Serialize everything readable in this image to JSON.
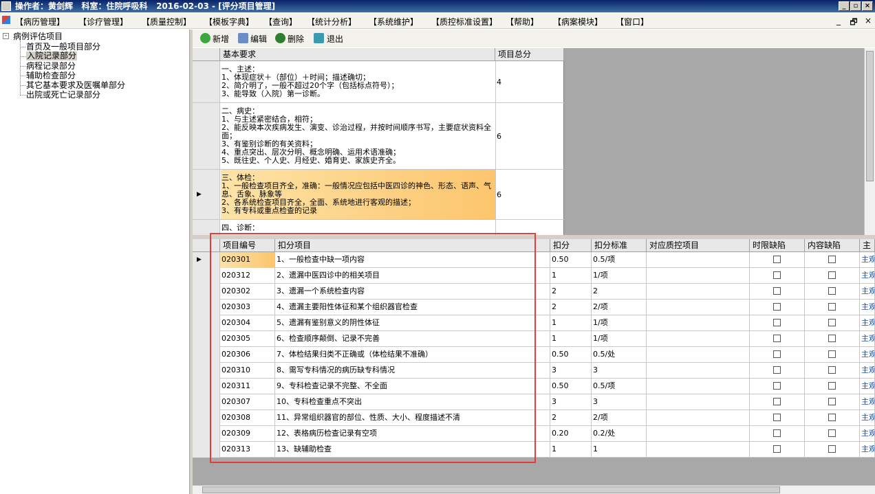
{
  "window": {
    "title": "操作者：黄剑辉   科室：住院呼吸科   2016-02-03 - [评分项目管理]",
    "min_label": "_",
    "restore_label": "▫",
    "close_label": "×"
  },
  "menu": [
    "【病历管理】",
    "【诊疗管理】",
    "【质量控制】",
    "【模板字典】",
    "【查询】",
    "【统计分析】",
    "【系统维护】",
    "【质控标准设置】",
    "【帮助】",
    "【病案模块】",
    "【窗口】"
  ],
  "mdi": [
    "_",
    "🗗",
    "×"
  ],
  "tree": {
    "root": "病例评估项目",
    "expand": "-",
    "items": [
      "首页及一般项目部分",
      "入院记录部分",
      "病程记录部分",
      "辅助检查部分",
      "其它基本要求及医嘱单部分",
      "出院或死亡记录部分"
    ],
    "selected_index": 1
  },
  "toolbar": {
    "new": "新增",
    "edit": "编辑",
    "delete": "删除",
    "exit": "退出"
  },
  "upper": {
    "headers": [
      "基本要求",
      "项目总分"
    ],
    "rows": [
      {
        "text": "一、主述：\n1、体现症状＋（部位）＋时间；描述确切；\n2、简介明了，一般不超过20个字（包括标点符号）；\n3、能导致（入院）第一诊断。",
        "score": "4"
      },
      {
        "text": "二、病史：\n1、与主述紧密结合，相符；\n2、能反映本次疾病发生、演变、诊治过程，并按时间顺序书写，主要症状资料全面；\n3、有鉴别诊断的有关资料；\n4、重点突出、层次分明、概念明确、运用术语准确；\n5、既往史、个人史、月经史、婚育史、家族史齐全。",
        "score": "6"
      },
      {
        "text": "三、体检：\n1、一般检查项目齐全，准确：一般情况应包括中医四诊的神色、形态、语声、气息、舌象、脉象等\n2、各系统检查项目齐全，全面、系统地进行客观的描述；\n3、有专科或重点检查的记录",
        "score": "6"
      },
      {
        "text": "四、诊断：",
        "score": ""
      }
    ]
  },
  "lower": {
    "headers": [
      "项目编号",
      "扣分项目",
      "扣分",
      "扣分标准",
      "对应质控项目",
      "时限缺陷",
      "内容缺陷",
      "主"
    ],
    "rows": [
      {
        "code": "020301",
        "item": "1、一般检查中缺一项内容",
        "deduct": "0.50",
        "std": "0.5/项",
        "tail": "主观"
      },
      {
        "code": "020312",
        "item": "2、遗漏中医四诊中的相关项目",
        "deduct": "1",
        "std": "1/项",
        "tail": "主观"
      },
      {
        "code": "020302",
        "item": "3、遗漏一个系统检查内容",
        "deduct": "2",
        "std": "2",
        "tail": "主观"
      },
      {
        "code": "020303",
        "item": "4、遗漏主要阳性体征和某个组织器官检查",
        "deduct": "2",
        "std": "2/项",
        "tail": "主观"
      },
      {
        "code": "020304",
        "item": "5、遗漏有鉴别意义的阴性体征",
        "deduct": "1",
        "std": "1/项",
        "tail": "主观"
      },
      {
        "code": "020305",
        "item": "6、检查顺序颠倒、记录不完善",
        "deduct": "1",
        "std": "1/项",
        "tail": "主观"
      },
      {
        "code": "020306",
        "item": "7、体检结果归类不正确或（体检结果不准确）",
        "deduct": "0.50",
        "std": "0.5/处",
        "tail": "主观"
      },
      {
        "code": "020310",
        "item": "8、需写专科情况的病历缺专科情况",
        "deduct": "3",
        "std": "3",
        "tail": "主观"
      },
      {
        "code": "020311",
        "item": "9、专科检查记录不完整、不全面",
        "deduct": "0.50",
        "std": "0.5/项",
        "tail": "主观"
      },
      {
        "code": "020307",
        "item": "10、专科检查重点不突出",
        "deduct": "3",
        "std": "3",
        "tail": "主观"
      },
      {
        "code": "020308",
        "item": "11、异常组织器官的部位、性质、大小、程度描述不清",
        "deduct": "2",
        "std": "2/项",
        "tail": "主观"
      },
      {
        "code": "020309",
        "item": "12、表格病历检查记录有空项",
        "deduct": "0.20",
        "std": "0.2/处",
        "tail": "主观"
      },
      {
        "code": "020313",
        "item": "13、缺辅助检查",
        "deduct": "1",
        "std": "1",
        "tail": "主观"
      }
    ]
  },
  "colors": {
    "highlight": "#e53b3b",
    "selection": "#fcc56d",
    "titlebar": "#0a246a"
  }
}
